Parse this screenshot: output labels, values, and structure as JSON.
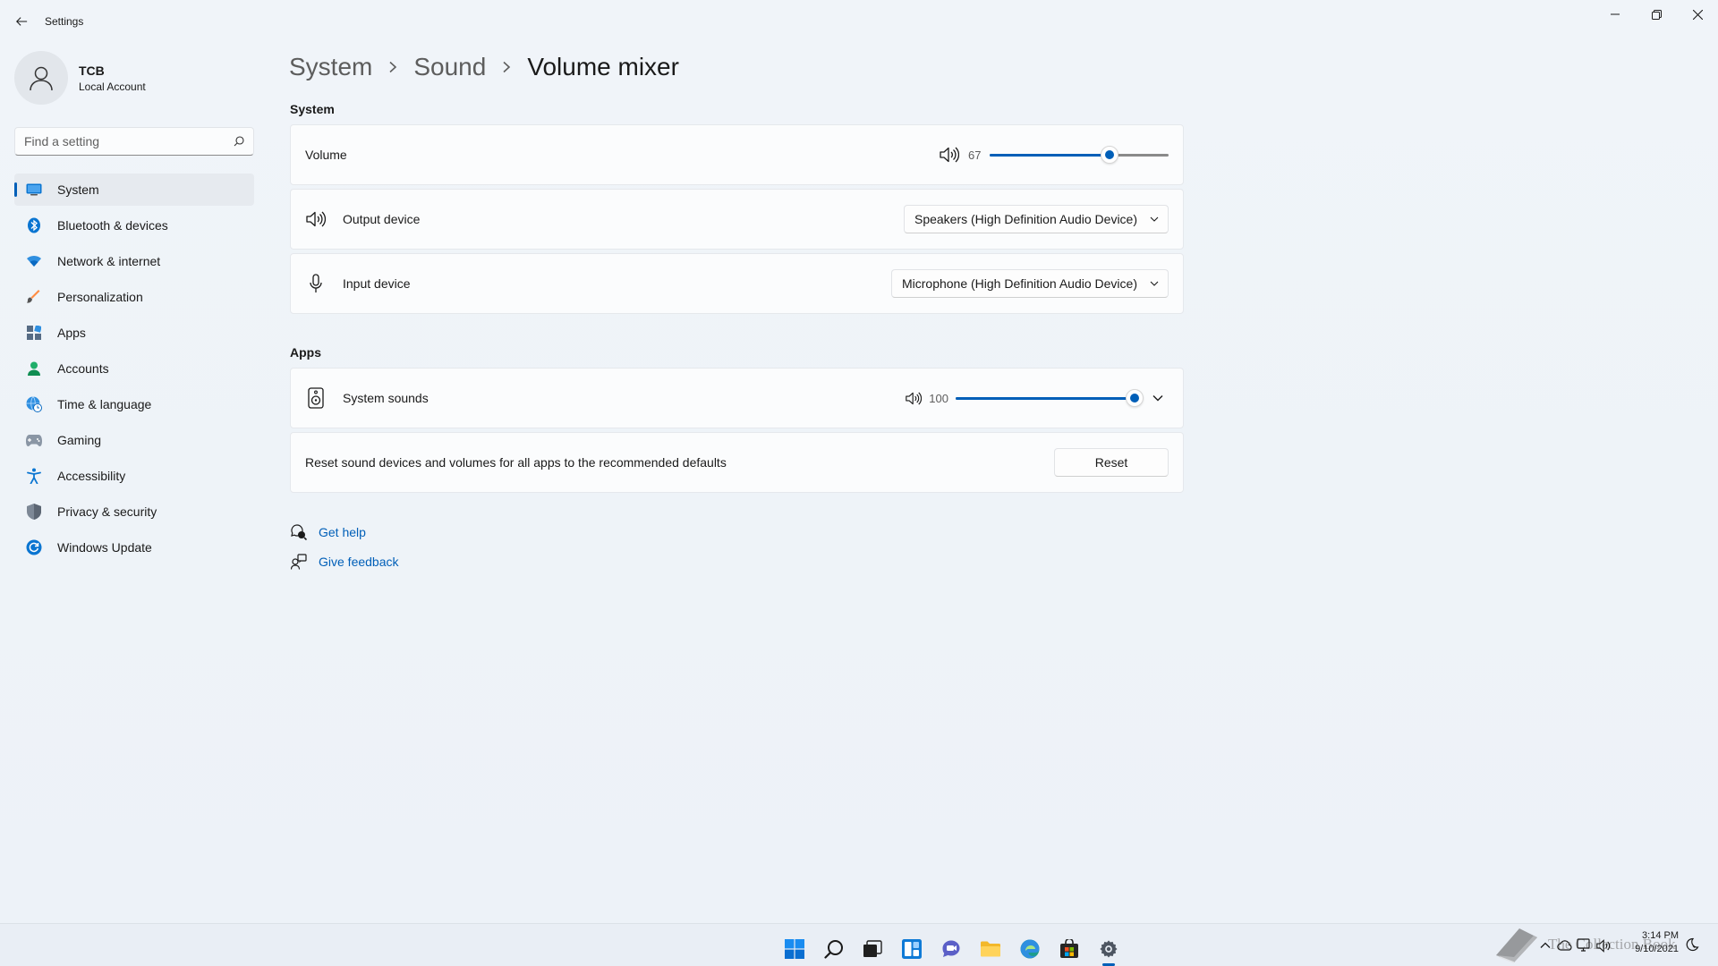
{
  "window": {
    "title": "Settings"
  },
  "profile": {
    "name": "TCB",
    "account_type": "Local Account"
  },
  "search": {
    "placeholder": "Find a setting"
  },
  "sidebar": {
    "items": [
      {
        "label": "System",
        "icon": "monitor-icon",
        "active": true
      },
      {
        "label": "Bluetooth & devices",
        "icon": "bluetooth-icon"
      },
      {
        "label": "Network & internet",
        "icon": "wifi-icon"
      },
      {
        "label": "Personalization",
        "icon": "brush-icon"
      },
      {
        "label": "Apps",
        "icon": "apps-icon"
      },
      {
        "label": "Accounts",
        "icon": "person-icon"
      },
      {
        "label": "Time & language",
        "icon": "globe-clock-icon"
      },
      {
        "label": "Gaming",
        "icon": "gamepad-icon"
      },
      {
        "label": "Accessibility",
        "icon": "accessibility-icon"
      },
      {
        "label": "Privacy & security",
        "icon": "shield-icon"
      },
      {
        "label": "Windows Update",
        "icon": "update-icon"
      }
    ]
  },
  "breadcrumb": {
    "items": [
      "System",
      "Sound"
    ],
    "current": "Volume mixer"
  },
  "system_section": {
    "heading": "System",
    "volume": {
      "label": "Volume",
      "value": 67
    },
    "output": {
      "label": "Output device",
      "selected": "Speakers (High Definition Audio Device)"
    },
    "input": {
      "label": "Input device",
      "selected": "Microphone (High Definition Audio Device)"
    }
  },
  "apps_section": {
    "heading": "Apps",
    "system_sounds": {
      "label": "System sounds",
      "value": 100
    },
    "reset": {
      "description": "Reset sound devices and volumes for all apps to the recommended defaults",
      "button_label": "Reset"
    }
  },
  "help": {
    "get_help": "Get help",
    "give_feedback": "Give feedback"
  },
  "taskbar": {
    "apps": [
      "start-icon",
      "search-icon",
      "task-view-icon",
      "widgets-icon",
      "teams-chat-icon",
      "file-explorer-icon",
      "edge-icon",
      "store-icon",
      "settings-icon"
    ]
  },
  "clock": {
    "time": "3:14 PM",
    "date": "9/10/2021"
  },
  "watermark": {
    "text": "The Collection Book"
  },
  "colors": {
    "accent": "#005fb8",
    "background": "#eef3f9",
    "card": "#fbfcfd"
  }
}
